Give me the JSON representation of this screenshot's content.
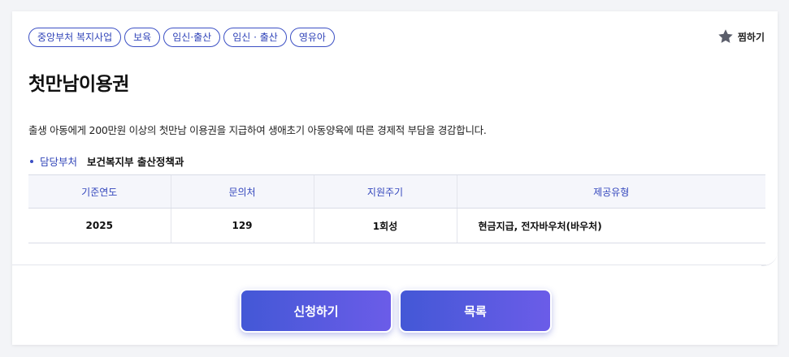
{
  "tags": [
    "중앙부처 복지사업",
    "보육",
    "임신·출산",
    "임신 · 출산",
    "영유아"
  ],
  "favorite": {
    "label": "찜하기",
    "icon": "star-icon",
    "color": "#5b5e6b"
  },
  "title": "첫만남이용권",
  "description": "출생 아동에게 200만원 이상의 첫만남 이용권을 지급하여 생애초기 아동양육에 따른 경제적 부담을 경감합니다.",
  "department": {
    "label": "담당부처",
    "value": "보건복지부 출산정책과"
  },
  "table": {
    "headers": [
      "기준연도",
      "문의처",
      "지원주기",
      "제공유형"
    ],
    "row": [
      "2025",
      "129",
      "1회성",
      "현금지급, 전자바우처(바우처)"
    ]
  },
  "buttons": {
    "apply": "신청하기",
    "list": "목록"
  },
  "colors": {
    "accent": "#3b4fc4",
    "button_start": "#4358d6",
    "button_end": "#6b5ce8"
  }
}
